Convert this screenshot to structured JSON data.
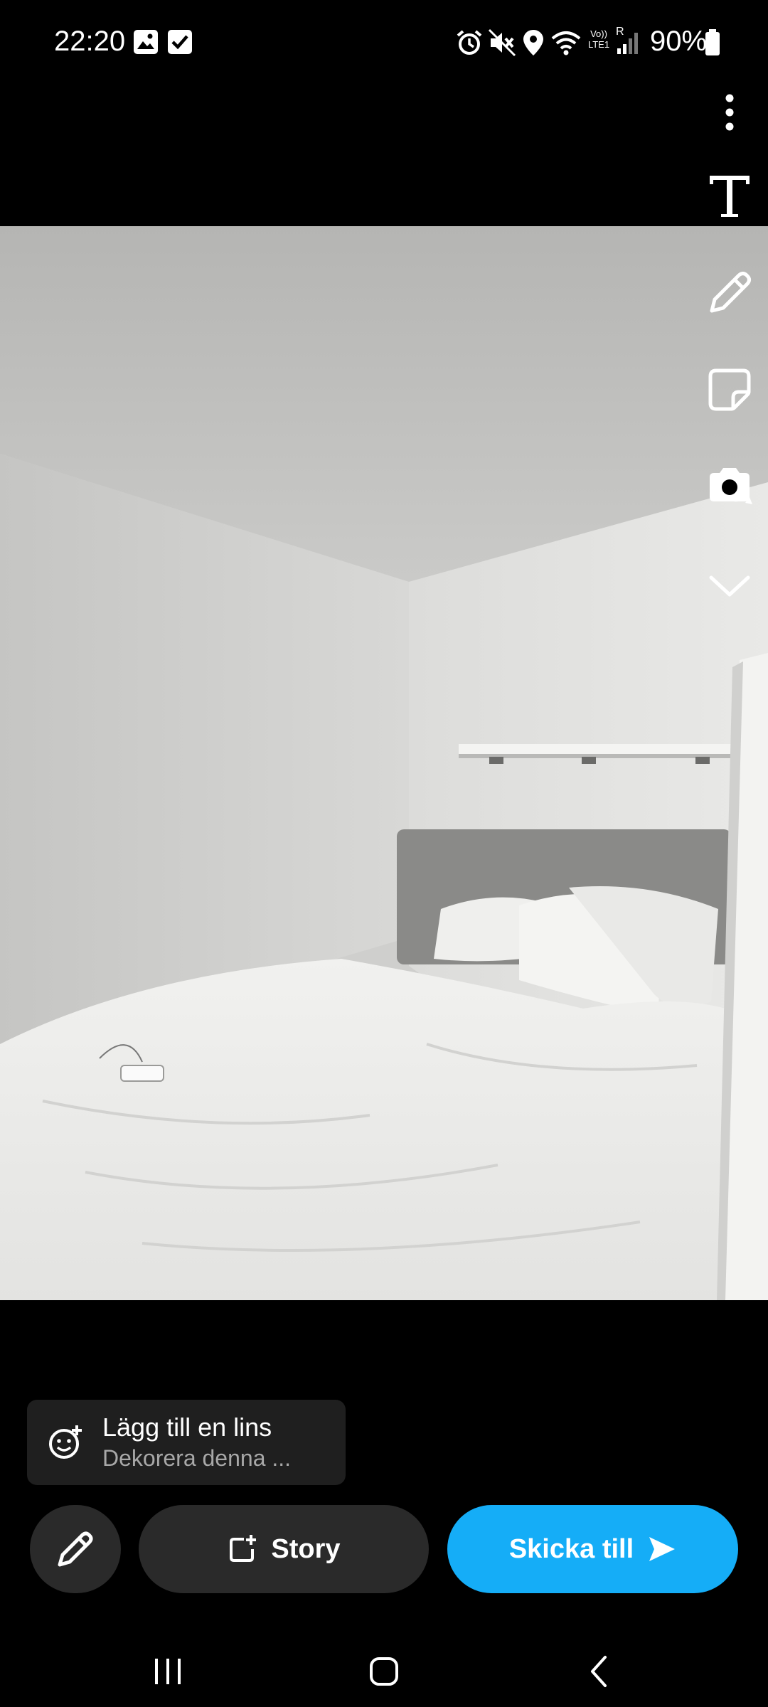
{
  "status_bar": {
    "time": "22:20",
    "battery": "90%",
    "network": "LTE1",
    "volte": "Vo))",
    "roaming": "R",
    "icons": [
      "image-icon",
      "checkbox-icon",
      "alarm-icon",
      "mute-icon",
      "location-icon",
      "wifi-icon",
      "signal-icon",
      "battery-icon"
    ]
  },
  "toolbar": {
    "items": [
      "more-options-icon",
      "text-tool-icon",
      "draw-tool-icon",
      "sticker-tool-icon",
      "camera-flip-icon",
      "expand-chevron-icon"
    ],
    "text_tool_glyph": "T"
  },
  "lens": {
    "title": "Lägg till en lins",
    "subtitle": "Dekorera denna ..."
  },
  "actions": {
    "story_label": "Story",
    "send_label": "Skicka till",
    "send_color": "#15adf7"
  },
  "navigation": {
    "items": [
      "recent-apps-icon",
      "home-icon",
      "back-icon"
    ]
  }
}
